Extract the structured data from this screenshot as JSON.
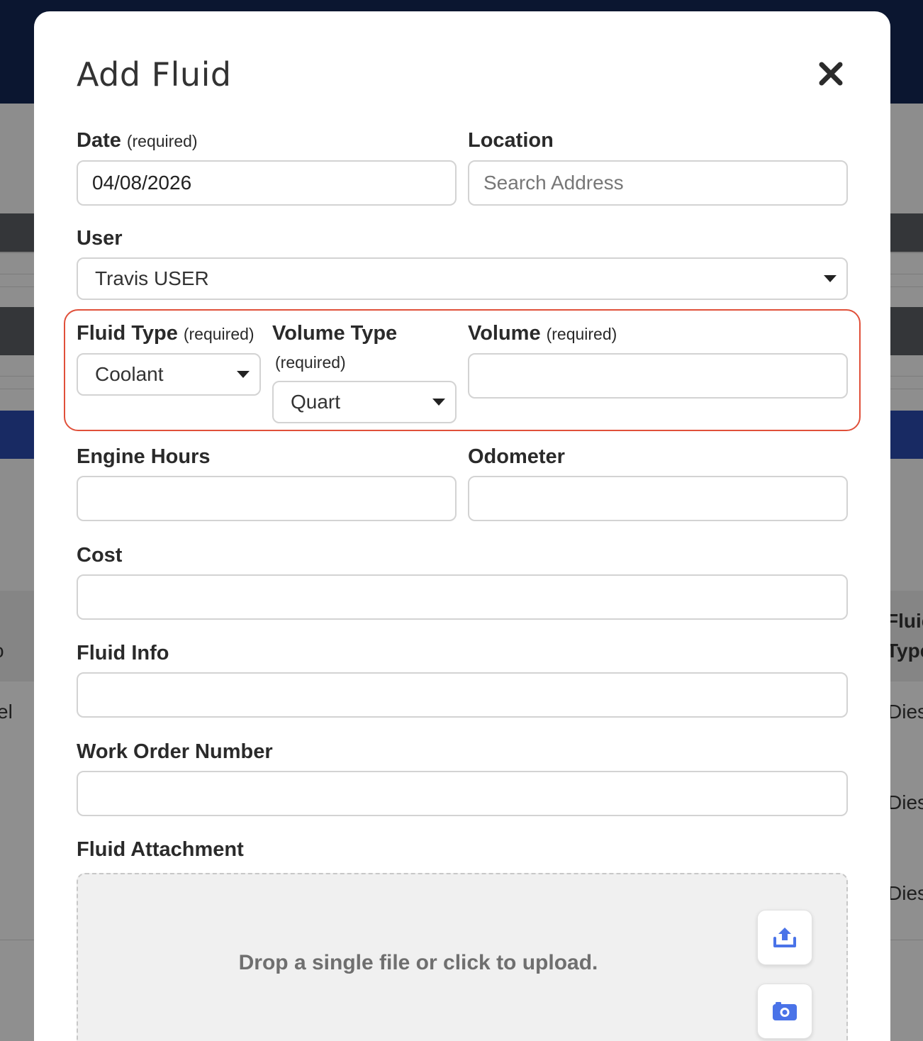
{
  "background": {
    "left_cells": [
      "o",
      "el"
    ],
    "right_cells": [
      "Fluic",
      "Type",
      "Dies",
      "Dies",
      "Dies"
    ]
  },
  "modal": {
    "title": "Add Fluid",
    "close_icon": "close-icon"
  },
  "form": {
    "date": {
      "label": "Date",
      "required": "(required)",
      "value": "04/08/2026"
    },
    "location": {
      "label": "Location",
      "placeholder": "Search Address"
    },
    "user": {
      "label": "User",
      "selected": "Travis USER"
    },
    "fluid_type": {
      "label": "Fluid Type",
      "required": "(required)",
      "selected": "Coolant"
    },
    "volume_type": {
      "label": "Volume Type",
      "required": "(required)",
      "selected": "Quart"
    },
    "volume": {
      "label": "Volume",
      "required": "(required)",
      "value": ""
    },
    "engine_hours": {
      "label": "Engine Hours",
      "value": ""
    },
    "odometer": {
      "label": "Odometer",
      "value": ""
    },
    "cost": {
      "label": "Cost",
      "value": ""
    },
    "fluid_info": {
      "label": "Fluid Info",
      "value": ""
    },
    "work_order_number": {
      "label": "Work Order Number",
      "value": ""
    },
    "fluid_attachment": {
      "label": "Fluid Attachment",
      "dropzone_text": "Drop a single file or click to upload.",
      "upload_icon": "upload-icon",
      "camera_icon": "camera-icon"
    }
  },
  "colors": {
    "highlight": "#e0503a",
    "icon_accent": "#4a73e8",
    "header_navy": "#0b1630"
  }
}
